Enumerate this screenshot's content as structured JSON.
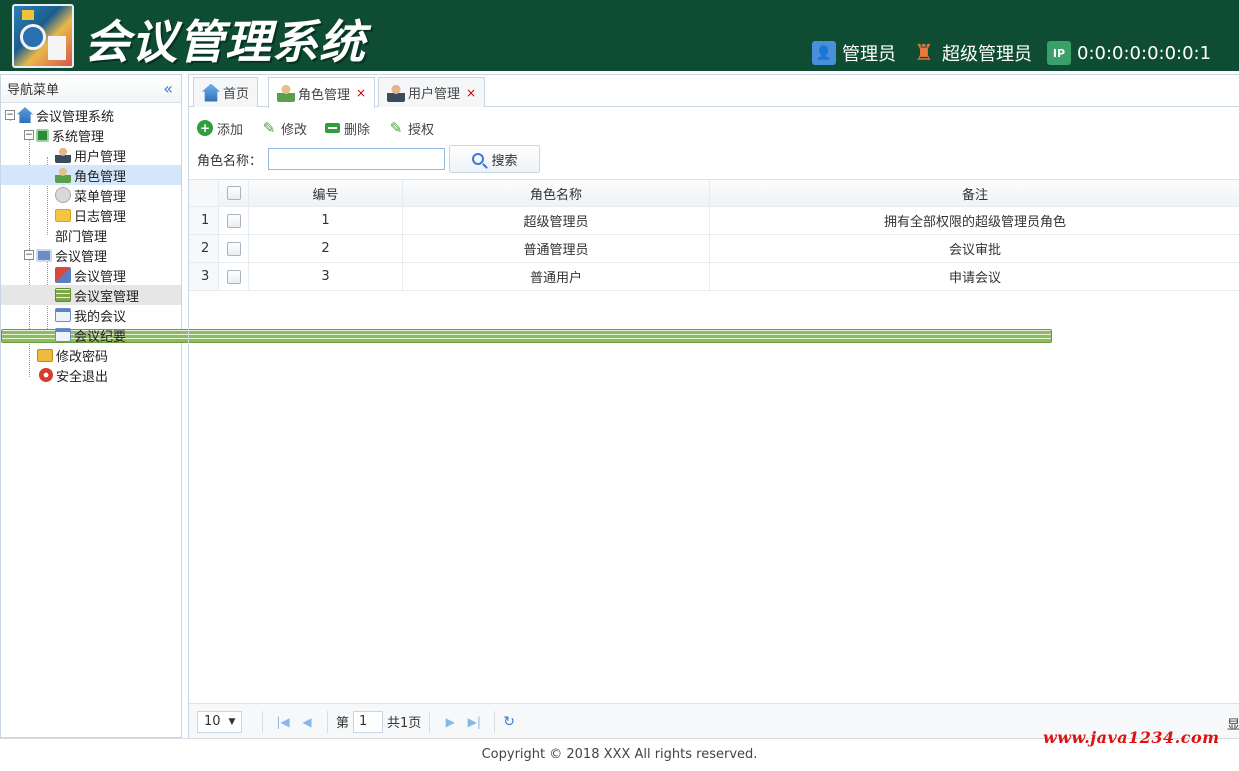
{
  "header": {
    "title": "会议管理系统",
    "user_role": "管理员",
    "user_name": "超级管理员",
    "ip": "0:0:0:0:0:0:0:1"
  },
  "sidebar": {
    "title": "导航菜单",
    "collapse_icon": "«",
    "tree": [
      {
        "label": "会议管理系统",
        "icon": "home-icon"
      },
      {
        "label": "系统管理",
        "icon": "green-square-icon"
      },
      {
        "label": "用户管理",
        "icon": "user-icon"
      },
      {
        "label": "角色管理",
        "icon": "role-icon",
        "selected": true
      },
      {
        "label": "菜单管理",
        "icon": "menu-icon"
      },
      {
        "label": "日志管理",
        "icon": "folder-icon"
      },
      {
        "label": "部门管理",
        "icon": "grid-icon"
      },
      {
        "label": "会议管理",
        "icon": "monitor-icon"
      },
      {
        "label": "会议管理",
        "icon": "meeting-icon"
      },
      {
        "label": "会议室管理",
        "icon": "room-icon",
        "hovered": true
      },
      {
        "label": "我的会议",
        "icon": "calendar-icon"
      },
      {
        "label": "会议纪要",
        "icon": "calendar-icon"
      },
      {
        "label": "修改密码",
        "icon": "key-icon"
      },
      {
        "label": "安全退出",
        "icon": "exit-icon"
      }
    ]
  },
  "tabs": [
    {
      "label": "首页",
      "closable": false
    },
    {
      "label": "角色管理",
      "closable": true,
      "active": true
    },
    {
      "label": "用户管理",
      "closable": true
    }
  ],
  "toolbar": {
    "add": "添加",
    "edit": "修改",
    "delete": "删除",
    "grant": "授权"
  },
  "search": {
    "label": "角色名称：",
    "value": "",
    "button": "搜索"
  },
  "table": {
    "columns": [
      "编号",
      "角色名称",
      "备注"
    ],
    "rows": [
      {
        "rownum": "1",
        "id": "1",
        "name": "超级管理员",
        "remark": "拥有全部权限的超级管理员角色"
      },
      {
        "rownum": "2",
        "id": "2",
        "name": "普通管理员",
        "remark": "会议审批"
      },
      {
        "rownum": "3",
        "id": "3",
        "name": "普通用户",
        "remark": "申请会议"
      }
    ]
  },
  "pager": {
    "page_size": "10",
    "page_prefix": "第",
    "page": "1",
    "total": "共1页",
    "right_trunc": "显"
  },
  "footer": {
    "copyright": "Copyright © 2018 XXX All rights reserved.",
    "watermark": "www.java1234.com"
  },
  "colors": {
    "header_bg": "#0e4d34",
    "accent": "#3a7bd5",
    "selected": "#d4e6fb",
    "watermark": "#e01010"
  }
}
